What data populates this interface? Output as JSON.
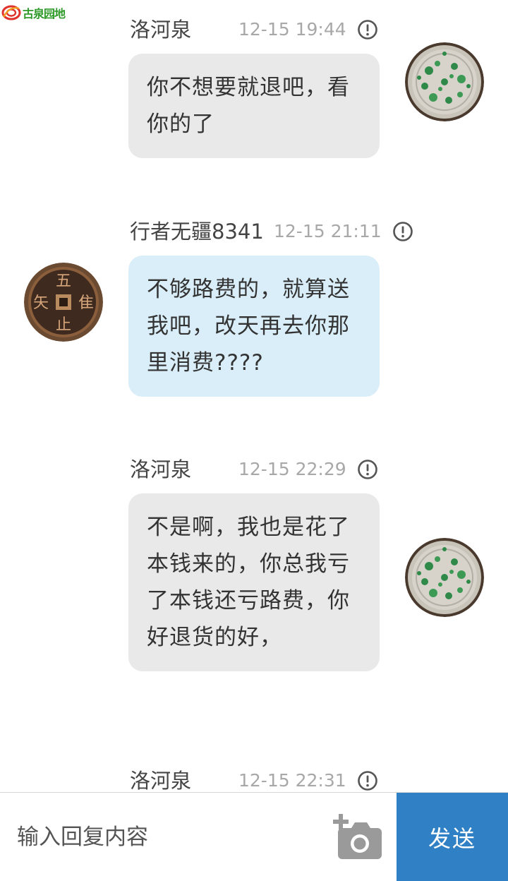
{
  "logo": {
    "text": "古泉园地"
  },
  "messages": [
    {
      "sender": "洛河泉",
      "time": "12-15 19:44",
      "text": "你不想要就退吧，看你的了",
      "side": "right",
      "bubble_color": "#e9e9e9",
      "avatar": "coin-green-patina"
    },
    {
      "sender": "行者无疆8341",
      "time": "12-15 21:11",
      "text": "不够路费的，就算送我吧，改天再去你那里消费????",
      "side": "left",
      "bubble_color": "#d9eef8",
      "avatar": "coin-wu-ji-zhi-zu"
    },
    {
      "sender": "洛河泉",
      "time": "12-15 22:29",
      "text": "不是啊，我也是花了本钱来的，你总我亏了本钱还亏路费，你好退货的好，",
      "side": "right",
      "bubble_color": "#e9e9e9",
      "avatar": "coin-green-patina"
    },
    {
      "sender": "洛河泉",
      "time": "12-15 22:31",
      "text": "",
      "side": "right"
    }
  ],
  "reply": {
    "placeholder": "输入回复内容",
    "send_label": "发送"
  },
  "icons": {
    "alert": "alert-circle-icon",
    "camera": "camera-add-icon"
  },
  "colors": {
    "send_button": "#2f80c4",
    "bubble_self": "#e9e9e9",
    "bubble_other": "#d9eef8",
    "timestamp": "#a8a8a8"
  }
}
